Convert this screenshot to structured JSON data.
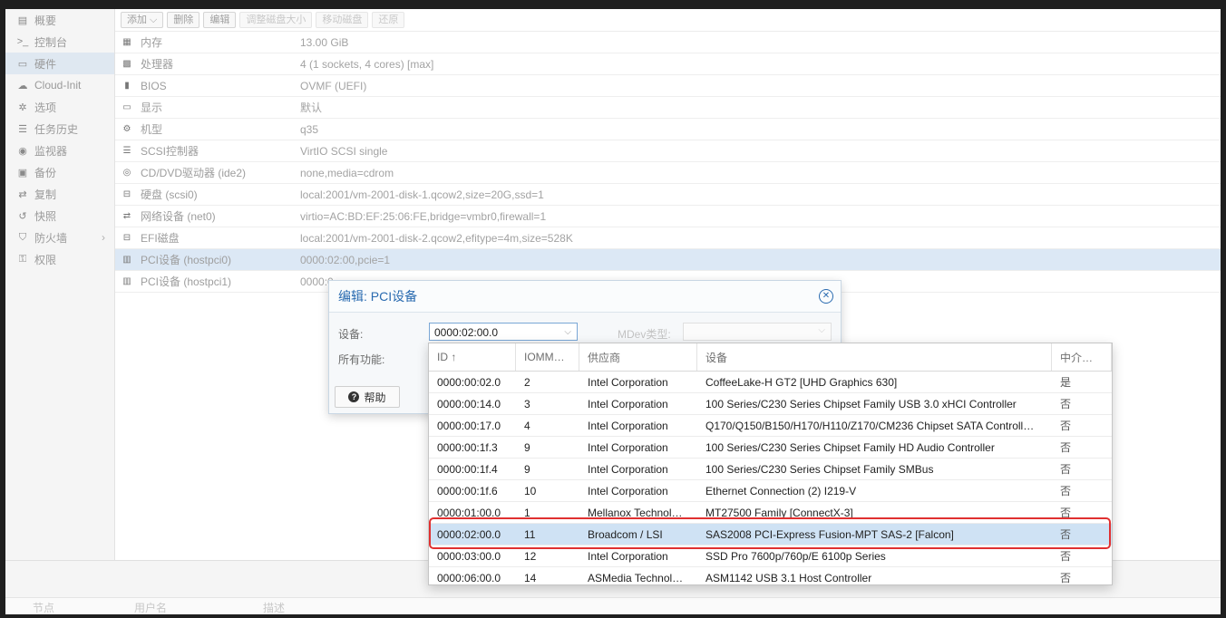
{
  "nav": {
    "items": [
      {
        "icon": "document-icon",
        "glyph": "▤",
        "label": "概要"
      },
      {
        "icon": "terminal-icon",
        "glyph": ">_",
        "label": "控制台"
      },
      {
        "icon": "monitor-icon",
        "glyph": "▭",
        "label": "硬件"
      },
      {
        "icon": "cloud-icon",
        "glyph": "☁",
        "label": "Cloud-Init"
      },
      {
        "icon": "gear-icon",
        "glyph": "✲",
        "label": "选项"
      },
      {
        "icon": "list-icon",
        "glyph": "☰",
        "label": "任务历史"
      },
      {
        "icon": "eye-icon",
        "glyph": "◉",
        "label": "监视器"
      },
      {
        "icon": "floppy-icon",
        "glyph": "▣",
        "label": "备份"
      },
      {
        "icon": "retweet-icon",
        "glyph": "⇄",
        "label": "复制"
      },
      {
        "icon": "history-icon",
        "glyph": "↺",
        "label": "快照"
      },
      {
        "icon": "shield-icon",
        "glyph": "⛉",
        "label": "防火墙"
      },
      {
        "icon": "unlock-icon",
        "glyph": "⚿",
        "label": "权限"
      }
    ]
  },
  "toolbar": {
    "add": "添加 ⌵",
    "remove": "删除",
    "edit": "编辑",
    "resize": "调整磁盘大小",
    "move": "移动磁盘",
    "revert": "还原"
  },
  "hardware": [
    {
      "icon": "memory-icon",
      "glyph": "▦",
      "key": "内存",
      "value": "13.00 GiB"
    },
    {
      "icon": "cpu-icon",
      "glyph": "▩",
      "key": "处理器",
      "value": "4 (1 sockets, 4 cores) [max]"
    },
    {
      "icon": "bios-icon",
      "glyph": "▮",
      "key": "BIOS",
      "value": "OVMF (UEFI)"
    },
    {
      "icon": "display-icon",
      "glyph": "▭",
      "key": "显示",
      "value": "默认"
    },
    {
      "icon": "cogs-icon",
      "glyph": "⚙",
      "key": "机型",
      "value": "q35"
    },
    {
      "icon": "database-icon",
      "glyph": "☰",
      "key": "SCSI控制器",
      "value": "VirtIO SCSI single"
    },
    {
      "icon": "cdrom-icon",
      "glyph": "◎",
      "key": "CD/DVD驱动器 (ide2)",
      "value": "none,media=cdrom"
    },
    {
      "icon": "hdd-icon",
      "glyph": "⊟",
      "key": "硬盘 (scsi0)",
      "value": "local:2001/vm-2001-disk-1.qcow2,size=20G,ssd=1"
    },
    {
      "icon": "exchange-icon",
      "glyph": "⇄",
      "key": "网络设备 (net0)",
      "value": "virtio=AC:BD:EF:25:06:FE,bridge=vmbr0,firewall=1"
    },
    {
      "icon": "hdd-icon",
      "glyph": "⊟",
      "key": "EFI磁盘",
      "value": "local:2001/vm-2001-disk-2.qcow2,efitype=4m,size=528K"
    },
    {
      "icon": "pci-icon",
      "glyph": "▥",
      "key": "PCI设备 (hostpci0)",
      "value": "0000:02:00,pcie=1"
    },
    {
      "icon": "pci-icon",
      "glyph": "▥",
      "key": "PCI设备 (hostpci1)",
      "value": "0000:0"
    }
  ],
  "bottom": {
    "col1": "节点",
    "col2": "用户名",
    "col3": "描述"
  },
  "dialog": {
    "title": "编辑: PCI设备",
    "device_label": "设备:",
    "device_value": "0000:02:00.0",
    "all_functions_label": "所有功能:",
    "mdev_label": "MDev类型:",
    "help": "帮助"
  },
  "grid": {
    "headers": [
      "ID ↑",
      "IOMM…",
      "供应商",
      "设备",
      "中介…"
    ],
    "rows": [
      [
        "0000:00:02.0",
        "2",
        "Intel Corporation",
        "CoffeeLake-H GT2 [UHD Graphics 630]",
        "是"
      ],
      [
        "0000:00:14.0",
        "3",
        "Intel Corporation",
        "100 Series/C230 Series Chipset Family USB 3.0 xHCI Controller",
        "否"
      ],
      [
        "0000:00:17.0",
        "4",
        "Intel Corporation",
        "Q170/Q150/B150/H170/H110/Z170/CM236 Chipset SATA Controll…",
        "否"
      ],
      [
        "0000:00:1f.3",
        "9",
        "Intel Corporation",
        "100 Series/C230 Series Chipset Family HD Audio Controller",
        "否"
      ],
      [
        "0000:00:1f.4",
        "9",
        "Intel Corporation",
        "100 Series/C230 Series Chipset Family SMBus",
        "否"
      ],
      [
        "0000:00:1f.6",
        "10",
        "Intel Corporation",
        "Ethernet Connection (2) I219-V",
        "否"
      ],
      [
        "0000:01:00.0",
        "1",
        "Mellanox Technol…",
        "MT27500 Family [ConnectX-3]",
        "否"
      ],
      [
        "0000:02:00.0",
        "11",
        "Broadcom / LSI",
        "SAS2008 PCI-Express Fusion-MPT SAS-2 [Falcon]",
        "否"
      ],
      [
        "0000:03:00.0",
        "12",
        "Intel Corporation",
        "SSD Pro 7600p/760p/E 6100p Series",
        "否"
      ],
      [
        "0000:06:00.0",
        "14",
        "ASMedia Technol…",
        "ASM1142 USB 3.1 Host Controller",
        "否"
      ]
    ]
  },
  "colors": {
    "accent": "#2a6bb0",
    "selection": "#cfe2f4",
    "highlight": "#e03030"
  }
}
